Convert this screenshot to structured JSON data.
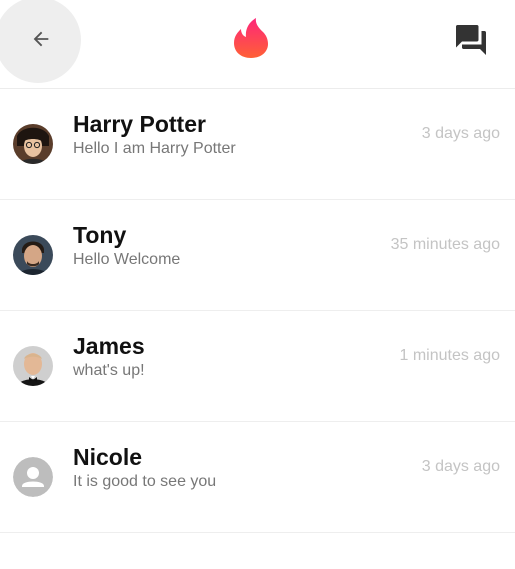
{
  "header": {
    "back_icon": "arrow-back-icon",
    "logo_icon": "flame-logo-icon",
    "forum_icon": "forum-icon",
    "colors": {
      "logo_top": "#fd267a",
      "logo_bottom": "#ff6036",
      "icon": "#333333",
      "back_circle": "#eeeeee"
    }
  },
  "conversations": [
    {
      "name": "Harry Potter",
      "message": "Hello I am Harry Potter",
      "time": "3 days ago"
    },
    {
      "name": "Tony",
      "message": "Hello Welcome",
      "time": "35 minutes ago"
    },
    {
      "name": "James",
      "message": "what's up!",
      "time": "1 minutes ago"
    },
    {
      "name": "Nicole",
      "message": "It is good to see you",
      "time": "3 days ago"
    }
  ]
}
